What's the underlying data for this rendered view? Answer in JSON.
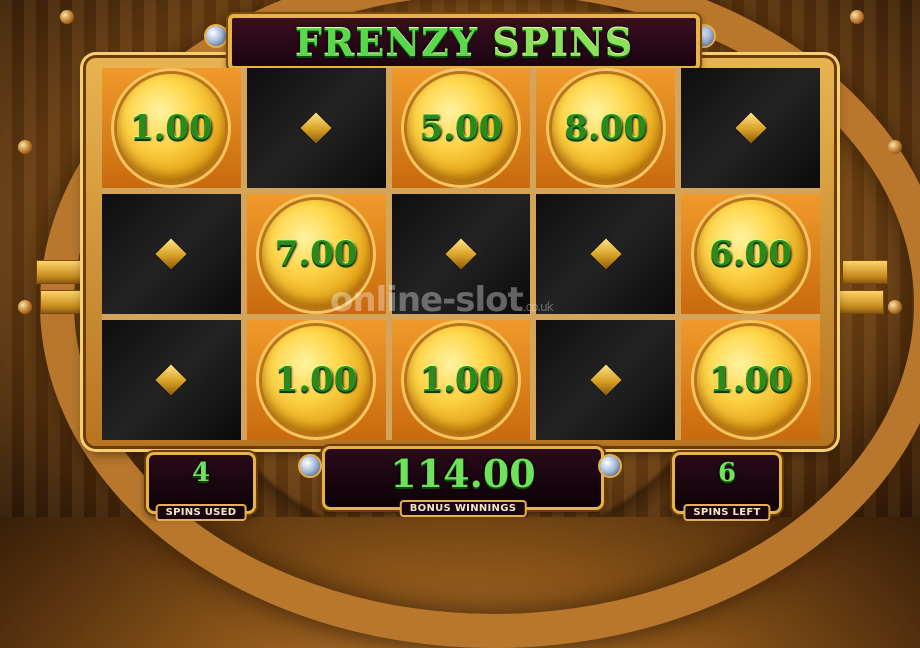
{
  "game": {
    "title_part1": "FRENZY",
    "title_part2": "SPINS"
  },
  "grid": {
    "rows": [
      [
        {
          "type": "coin",
          "value": "1.00"
        },
        {
          "type": "blank",
          "value": ""
        },
        {
          "type": "coin",
          "value": "5.00"
        },
        {
          "type": "coin",
          "value": "8.00"
        },
        {
          "type": "blank",
          "value": ""
        }
      ],
      [
        {
          "type": "blank",
          "value": ""
        },
        {
          "type": "coin",
          "value": "7.00"
        },
        {
          "type": "blank",
          "value": ""
        },
        {
          "type": "blank",
          "value": ""
        },
        {
          "type": "coin",
          "value": "6.00"
        }
      ],
      [
        {
          "type": "blank",
          "value": ""
        },
        {
          "type": "coin",
          "value": "1.00"
        },
        {
          "type": "coin",
          "value": "1.00"
        },
        {
          "type": "blank",
          "value": ""
        },
        {
          "type": "coin",
          "value": "1.00"
        }
      ]
    ]
  },
  "panels": {
    "spins_used_value": "4",
    "spins_used_label": "SPINS USED",
    "bonus_winnings_value": "114.00",
    "bonus_winnings_label": "BONUS WINNINGS",
    "spins_left_value": "6",
    "spins_left_label": "SPINS LEFT"
  },
  "watermark": {
    "text": "online-slot",
    "suffix": ".co.uk"
  }
}
